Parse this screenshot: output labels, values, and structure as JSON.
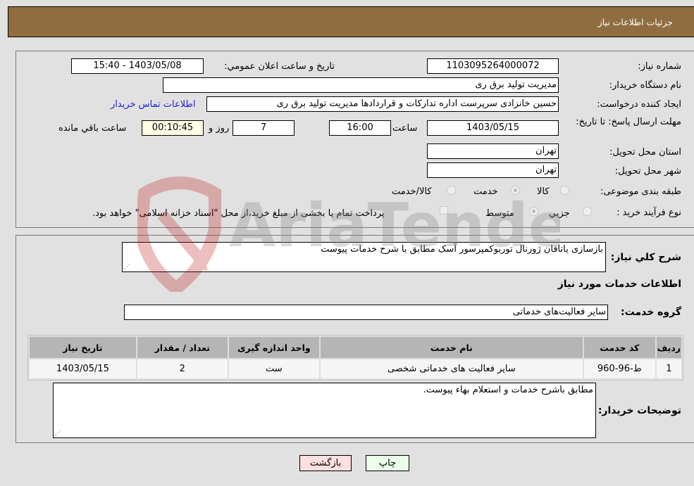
{
  "header": {
    "title": "جزئیات اطلاعات نیاز"
  },
  "details": {
    "need_number_label": "شماره نیاز:",
    "need_number": "1103095264000072",
    "announce_label": "تاریخ و ساعت اعلان عمومي:",
    "announce_value": "1403/05/08 - 15:40",
    "buyer_org_label": "نام دستگاه خریدار:",
    "buyer_org": "مدیریت تولید برق ری",
    "creator_label": "ایجاد کننده درخواست:",
    "creator": "حسین خانزادی سرپرست اداره تدارکات و قراردادها مدیریت تولید برق ری",
    "contact_link": "اطلاعات تماس خریدار",
    "deadline_label": "مهلت ارسال پاسخ: تا تاریخ:",
    "deadline_date": "1403/05/15",
    "time_label": "ساعت",
    "deadline_time": "16:00",
    "days_value": "7",
    "days_label": "روز و",
    "remaining_time": "00:10:45",
    "remaining_label": "ساعت باقي مانده",
    "province_label": "استان محل تحویل:",
    "province": "تهران",
    "city_label": "شهر محل تحویل:",
    "city": "تهران",
    "category_label": "طبقه بندی موضوعی:",
    "category_options": [
      {
        "label": "کالا",
        "selected": false
      },
      {
        "label": "خدمت",
        "selected": true
      },
      {
        "label": "کالا/خدمت",
        "selected": false
      }
    ],
    "process_label": "نوع فرآیند خرید :",
    "process_options": [
      {
        "label": "جزيي",
        "selected": false
      },
      {
        "label": "متوسط",
        "selected": true
      }
    ],
    "treasury_note": "پرداخت تمام یا بخشی از مبلغ خرید،از محل \"اسناد خزانه اسلامی\" خواهد بود.",
    "treasury_checked": false
  },
  "services": {
    "summary_label": "شرح کلي نیاز:",
    "summary": "بازسازی یاتاقان ژورنال توربوکمپرسور آسک مطابق با شرح خدمات پیوست",
    "section_title": "اطلاعات خدمات مورد نیاز",
    "group_label": "گروه خدمت:",
    "group_value": "سایر فعالیت‌های خدماتی",
    "table": {
      "headers": [
        "ردیف",
        "کد خدمت",
        "نام خدمت",
        "واحد اندازه گیری",
        "تعداد / مقدار",
        "تاریخ نیاز"
      ],
      "rows": [
        [
          "1",
          "ط-96-960",
          "سایر فعالیت های خدماتی شخصی",
          "ست",
          "2",
          "1403/05/15"
        ]
      ]
    },
    "buyer_notes_label": "توضیحات خریدار:",
    "buyer_notes": "مطابق باشرح خدمات و استعلام بهاء پیوست."
  },
  "buttons": {
    "print": "چاپ",
    "back": "بازگشت"
  },
  "watermark": {
    "text": "AriaTender.neT"
  },
  "colors": {
    "header_bg": "#8f6d41",
    "link": "#2020d8",
    "print_bg": "#eaffea",
    "back_bg": "#ffdfdf",
    "remaining_bg": "#ffffe6"
  }
}
